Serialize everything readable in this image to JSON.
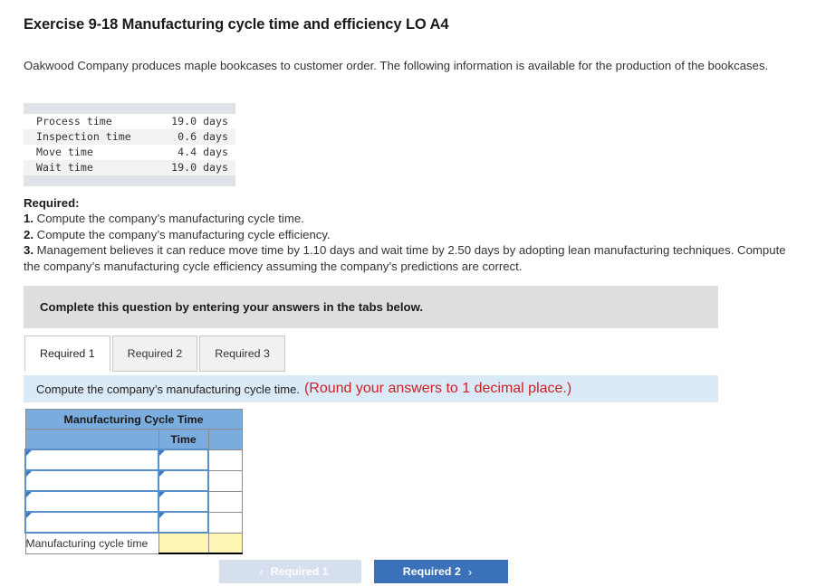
{
  "page_title": "Exercise 9-18 Manufacturing cycle time and efficiency LO A4",
  "intro": "Oakwood Company produces maple bookcases to customer order. The following information is available for the production of the bookcases.",
  "given_data": {
    "rows": [
      {
        "label": "Process time",
        "value": "19.0 days"
      },
      {
        "label": "Inspection time",
        "value": "0.6 days"
      },
      {
        "label": "Move time",
        "value": "4.4 days"
      },
      {
        "label": "Wait time",
        "value": "19.0 days"
      }
    ]
  },
  "required": {
    "heading": "Required:",
    "items": [
      {
        "num": "1.",
        "text": "Compute the company’s manufacturing cycle time."
      },
      {
        "num": "2.",
        "text": "Compute the company’s manufacturing cycle efficiency."
      },
      {
        "num": "3.",
        "text": "Management believes it can reduce move time by 1.10 days and wait time by 2.50 days by adopting lean manufacturing techniques. Compute the company’s manufacturing cycle efficiency assuming the company’s predictions are correct."
      }
    ]
  },
  "grey_banner": "Complete this question by entering your answers in the tabs below.",
  "tabs": [
    {
      "label": "Required 1",
      "active": true
    },
    {
      "label": "Required 2",
      "active": false
    },
    {
      "label": "Required 3",
      "active": false
    }
  ],
  "blue_bar": {
    "text": "Compute the company’s manufacturing cycle time.",
    "note": "(Round your answers to 1 decimal place.)"
  },
  "answer_table": {
    "title": "Manufacturing Cycle Time",
    "column_header_time": "Time",
    "input_rows": [
      {
        "label": "",
        "time": ""
      },
      {
        "label": "",
        "time": ""
      },
      {
        "label": "",
        "time": ""
      },
      {
        "label": "",
        "time": ""
      }
    ],
    "total_row": {
      "label": "Manufacturing cycle time",
      "time": "",
      "extra": ""
    }
  },
  "nav": {
    "prev_label": "Required 1",
    "prev_chevron": "‹",
    "next_label": "Required 2",
    "next_chevron": "›"
  },
  "colors": {
    "tab_active_bg": "#ffffff",
    "tab_inactive_bg": "#f1f1f1",
    "grey_banner_bg": "#dedede",
    "blue_bar_bg": "#daeaf7",
    "note_red": "#cc2127",
    "table_header_blue": "#7aadde",
    "input_border_blue": "#5b8fc7",
    "yellow_cell": "#fcf5b4",
    "nav_next_bg": "#3a71b8",
    "nav_prev_bg": "#d5dfee"
  }
}
